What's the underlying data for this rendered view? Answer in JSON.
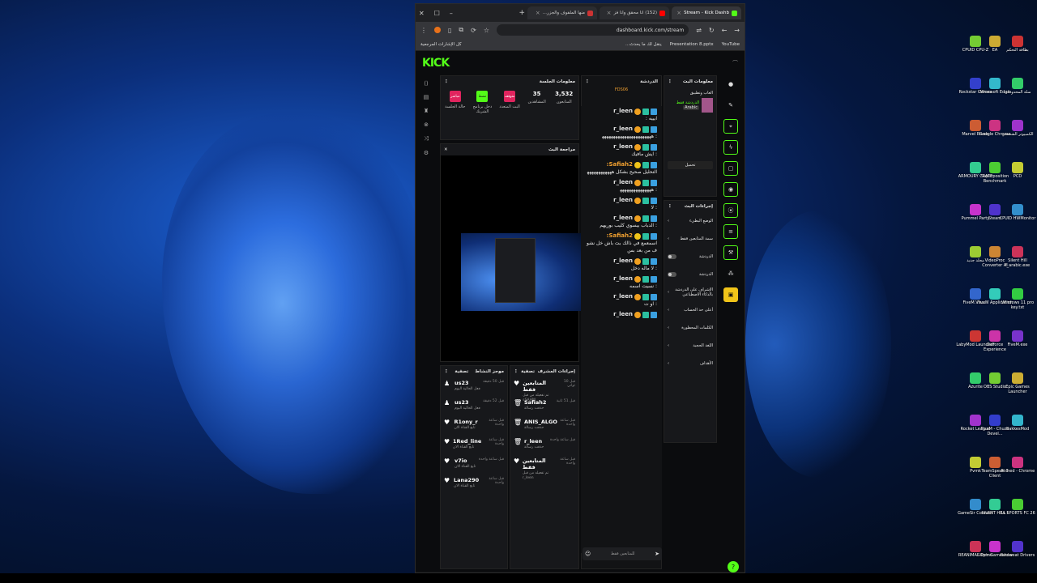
{
  "browser": {
    "tabs": [
      {
        "title": "Stream - Kick Dashb",
        "active": true
      },
      {
        "title": "(152) انا محقق وانا فز",
        "active": false
      },
      {
        "title": "منها الملفوف والجزر...",
        "active": false
      }
    ],
    "url": "dashboard.kick.com/stream",
    "bookmarks": [
      "YouTube",
      "Presentation 8.pptx",
      "ينقل لك ما يحدث...",
      "كل الإشارات المرجعية"
    ]
  },
  "kick": {
    "logo": "KICK",
    "session": {
      "title": "معلومات الجلسة",
      "stats": [
        {
          "value": "3,532",
          "label": "المتابعون"
        },
        {
          "value": "35",
          "label": "المشاهدين"
        },
        {
          "label": "البث المتعدد",
          "badge": "متوقف",
          "color": "#e0245e"
        },
        {
          "label": "دخل برنامج الشريك",
          "badge": "نشط",
          "color": "#53fc18"
        },
        {
          "label": "حالة الجلسة",
          "badge": "مباشر",
          "color": "#e0245e"
        }
      ]
    },
    "preview": {
      "title": "مراجعة البث"
    },
    "chat": {
      "title": "الدردشة",
      "pinned": "FDS06",
      "messages": [
        {
          "user": "r_leen",
          "text": "ابييه :"
        },
        {
          "user": "r_leen",
          "text": ": ﻫﻬﻬﻬﻬﻬﻬﻬﻬﻬﻬﻬﻬﻬﻬﻬﻬﻬﻬﻬﻬﻬﻬ"
        },
        {
          "user": "r_leen",
          "text": ": ايش مافيك"
        },
        {
          "user": "Safiah2:",
          "text": "التحليل صحيح بشكل ﻫﻬﻬﻬﻬﻬﻬﻬﻬﻬﻬﻬ",
          "gold": true
        },
        {
          "user": "r_leen",
          "text": ": ﻫﻬﻬﻬﻬﻬﻬﻬﻬﻬﻬﻬﻬﻬﻬ"
        },
        {
          "user": "r_leen",
          "text": ": لا"
        },
        {
          "user": "r_leen",
          "text": ": الدباب بيسوي كليب بوريهم"
        },
        {
          "user": "Safiah2:",
          "text": "اسمعمع في ذالك بث باش خل نشوف من بعد بس",
          "gold": true
        },
        {
          "user": "r_leen",
          "text": ": لا ماله دخل"
        },
        {
          "user": "r_leen",
          "text": ": نسيت اسمه"
        },
        {
          "user": "r_leen",
          "text": ": او ت"
        },
        {
          "user": "r_leen",
          "text": ""
        }
      ],
      "footer": "للمتابعين فقط"
    },
    "channel": {
      "title": "معلومات البث",
      "category": "العاب وتطبيق",
      "stream_title": "الدردشة فقط",
      "language": "Arabic",
      "edit": "تحميل"
    },
    "actions": {
      "title": "إجراءات البث",
      "items": [
        {
          "label": "الوضع البطيء",
          "type": "arrow"
        },
        {
          "label": "سمة المتابعين فقط",
          "type": "arrow"
        },
        {
          "label": "الدردشة",
          "type": "toggle"
        },
        {
          "label": "الدردشة",
          "type": "toggle"
        },
        {
          "label": "الإشراف على الدردشة بالذكاء الاصطناعي",
          "type": "arrow"
        },
        {
          "label": "أعلى حد الحساب",
          "type": "arrow"
        },
        {
          "label": "الكلمات المحظورة",
          "type": "arrow"
        },
        {
          "label": "اللغة الحجبة",
          "type": "arrow"
        },
        {
          "label": "الأهداف",
          "type": "arrow"
        }
      ]
    },
    "activity": {
      "title": "موجز النشاط",
      "filter": "تصفية",
      "items": [
        {
          "name": "us23",
          "sub": "فعل الحالية اليوم",
          "time": "قبل 50 دقيقة",
          "icon": "user"
        },
        {
          "name": "us23",
          "sub": "فعل الحالية اليوم",
          "time": "قبل 52 دقيقة",
          "icon": "user"
        },
        {
          "name": "R1ony_r",
          "sub": "تابع القناة الان",
          "time": "قبل ساعة واحدة",
          "icon": "heart"
        },
        {
          "name": "1Red_line",
          "sub": "تابع القناة الان",
          "time": "قبل ساعة واحدة",
          "icon": "heart"
        },
        {
          "name": "v7io",
          "sub": "تابع القناة الان",
          "time": "قبل ساعة واحدة",
          "icon": "heart"
        },
        {
          "name": "Lana290",
          "sub": "تابع القناة الان",
          "time": "قبل ساعة واحدة",
          "icon": "heart"
        }
      ]
    },
    "modlog": {
      "title": "إجراءات المشرف",
      "filter": "تصفية",
      "items": [
        {
          "name": "المتابعين فقط",
          "sub": "تم تفعيله من قبل sSAHM",
          "time": "قبل 10 ثواني",
          "icon": "heart"
        },
        {
          "name": "Safiah2",
          "sub": "حذفت رسالة",
          "time": "قبل 51 ثانية",
          "icon": "trash"
        },
        {
          "name": "ANIS_ALGO",
          "sub": "حذفت رسالة",
          "time": "قبل ساعة واحدة",
          "icon": "trash"
        },
        {
          "name": "r_leen",
          "sub": "حذفت رسالة",
          "time": "قبل ساعة واحدة",
          "icon": "trash"
        },
        {
          "name": "المتابعين فقط",
          "sub": "تم تفعيله من قبل r_leen",
          "time": "قبل ساعة واحدة",
          "icon": "heart"
        }
      ]
    }
  },
  "desktop": {
    "icons": [
      "بطاقة التحكم",
      "EA",
      "CPUID CPU-Z",
      "سلة المحذوفات",
      "Microsoft Edge",
      "Rockstar Games",
      "الكمبيوتر الشخصي",
      "Google Chrome",
      "Marvel Rivals",
      "PCD",
      "Superposition Benchmark",
      "ARMOURY CRATE",
      "CPUID HWMonitor",
      "Steam",
      "Pummel Party",
      "Silent Hill f_arabic.exe",
      "VideoProc Converter AI",
      "مجلد جديد",
      "Windows 11 pro key.txt",
      "FiveM Application",
      "FiveM.Visu...",
      "FiveM.exe",
      "GeForce Experience",
      "LabyMod Launcher",
      "Epic Games Launcher",
      "OBS Studio",
      "Azurite",
      "BakkesMod",
      "FiveM - Chuze Devel...",
      "Rocket League",
      "Ahmed - Chrome",
      "TeamSpeak 3 Client",
      "Pvmk",
      "EA SPORTS FC 26",
      "SILENT HILL f",
      "GameSir Connect",
      "Backseat Drivers",
      "Silly's Gameshow",
      "REANIMAL Demo"
    ]
  },
  "colors": {
    "accent": "#53fc18",
    "live": "#e0245e",
    "chat_bg": "#121315"
  }
}
